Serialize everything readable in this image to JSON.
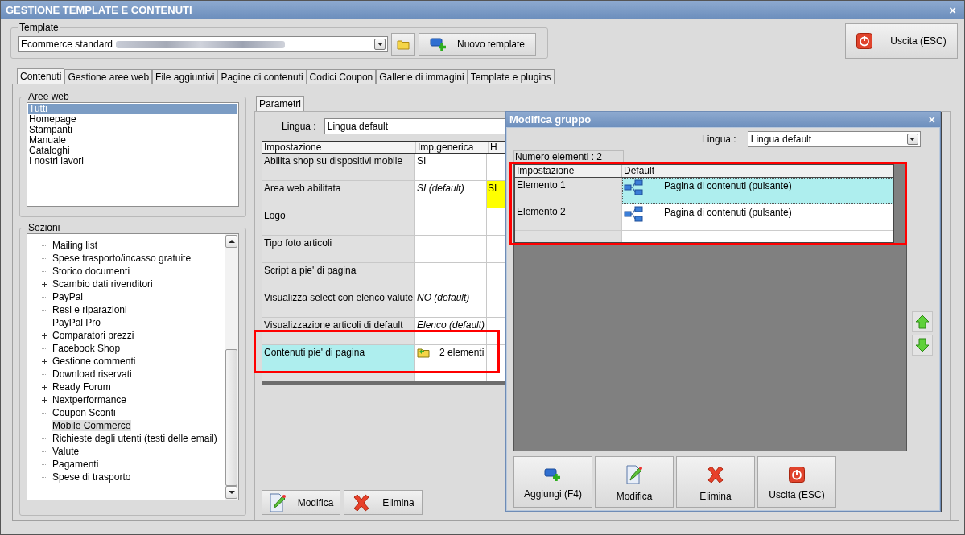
{
  "window": {
    "title": "GESTIONE TEMPLATE E CONTENUTI",
    "close": "×"
  },
  "template": {
    "legend": "Template",
    "value": "Ecommerce standard",
    "new_button": "Nuovo template"
  },
  "exit_button": "Uscita (ESC)",
  "tabs": [
    {
      "label": "Contenuti",
      "selected": true
    },
    {
      "label": "Gestione aree web",
      "selected": false
    },
    {
      "label": "File aggiuntivi",
      "selected": false
    },
    {
      "label": "Pagine di contenuti",
      "selected": false
    },
    {
      "label": "Codici Coupon",
      "selected": false
    },
    {
      "label": "Gallerie di immagini",
      "selected": false
    },
    {
      "label": "Template e plugins",
      "selected": false
    }
  ],
  "web_areas": {
    "legend": "Aree web",
    "items": [
      {
        "label": "Tutti",
        "selected": true
      },
      {
        "label": "Homepage",
        "selected": false
      },
      {
        "label": "Stampanti",
        "selected": false
      },
      {
        "label": "Manuale",
        "selected": false
      },
      {
        "label": "Cataloghi",
        "selected": false
      },
      {
        "label": "I nostri lavori",
        "selected": false
      }
    ]
  },
  "sections": {
    "legend": "Sezioni",
    "items": [
      {
        "label": "Mailing list",
        "expandable": false,
        "selected": false
      },
      {
        "label": "Spese trasporto/incasso gratuite",
        "expandable": false,
        "selected": false
      },
      {
        "label": "Storico documenti",
        "expandable": false,
        "selected": false
      },
      {
        "label": "Scambio dati rivenditori",
        "expandable": true,
        "selected": false
      },
      {
        "label": "PayPal",
        "expandable": false,
        "selected": false
      },
      {
        "label": "Resi e riparazioni",
        "expandable": false,
        "selected": false
      },
      {
        "label": "PayPal Pro",
        "expandable": false,
        "selected": false
      },
      {
        "label": "Comparatori prezzi",
        "expandable": true,
        "selected": false
      },
      {
        "label": "Facebook Shop",
        "expandable": false,
        "selected": false
      },
      {
        "label": "Gestione commenti",
        "expandable": true,
        "selected": false
      },
      {
        "label": "Download riservati",
        "expandable": false,
        "selected": false
      },
      {
        "label": "Ready Forum",
        "expandable": true,
        "selected": false
      },
      {
        "label": "Nextperformance",
        "expandable": true,
        "selected": false
      },
      {
        "label": "Coupon Sconti",
        "expandable": false,
        "selected": false
      },
      {
        "label": "Mobile Commerce",
        "expandable": false,
        "selected": true
      },
      {
        "label": "Richieste degli utenti (testi delle email)",
        "expandable": false,
        "selected": false
      },
      {
        "label": "Valute",
        "expandable": false,
        "selected": false
      },
      {
        "label": "Pagamenti",
        "expandable": false,
        "selected": false
      },
      {
        "label": "Spese di trasporto",
        "expandable": false,
        "selected": false
      }
    ]
  },
  "parameters": {
    "tab": "Parametri",
    "language_label": "Lingua :",
    "language_value": "Lingua default",
    "columns": [
      "Impostazione",
      "Imp.generica",
      "H"
    ],
    "rows": [
      {
        "setting": "Abilita shop su dispositivi mobile",
        "generic": "SI",
        "generic_default": false,
        "column_3": "",
        "selected": false,
        "kind": "text"
      },
      {
        "setting": "Area web abilitata",
        "generic": "SI (default)",
        "generic_default": true,
        "column_3": "SI",
        "selected": false,
        "kind": "text"
      },
      {
        "setting": "Logo",
        "column_3": "",
        "selected": false,
        "kind": "text"
      },
      {
        "setting": "Tipo foto articoli",
        "column_3": "",
        "selected": false,
        "kind": "text"
      },
      {
        "setting": "Script a pie' di pagina",
        "column_3": "",
        "selected": false,
        "kind": "text"
      },
      {
        "setting": "Visualizza select con elenco valute",
        "generic": "NO (default)",
        "generic_default": true,
        "column_3": "",
        "selected": false,
        "kind": "text"
      },
      {
        "setting": "Visualizzazione articoli di default",
        "generic": "Elenco (default)",
        "generic_default": true,
        "column_3": "",
        "selected": false,
        "kind": "text"
      },
      {
        "setting": "Contenuti pie' di pagina",
        "generic": "2 elementi",
        "generic_default": false,
        "column_3": "",
        "selected": true,
        "kind": "group"
      }
    ],
    "buttons": [
      "Modifica",
      "Elimina"
    ]
  },
  "dialog": {
    "title": "Modifica gruppo",
    "close": "×",
    "language_label": "Lingua :",
    "language_value": "Lingua default",
    "count": "Numero elementi : 2",
    "columns": [
      "Impostazione",
      "Default"
    ],
    "rows": [
      {
        "name": "Elemento 1",
        "value": "Pagina di contenuti (pulsante)",
        "selected": true
      },
      {
        "name": "Elemento 2",
        "value": "Pagina di contenuti (pulsante)",
        "selected": false
      }
    ],
    "buttons": [
      {
        "label": "Aggiungi (F4)",
        "kind": "add"
      },
      {
        "label": "Modifica",
        "kind": "edit"
      },
      {
        "label": "Elimina",
        "kind": "delete"
      },
      {
        "label": "Uscita (ESC)",
        "kind": "exit"
      }
    ]
  }
}
